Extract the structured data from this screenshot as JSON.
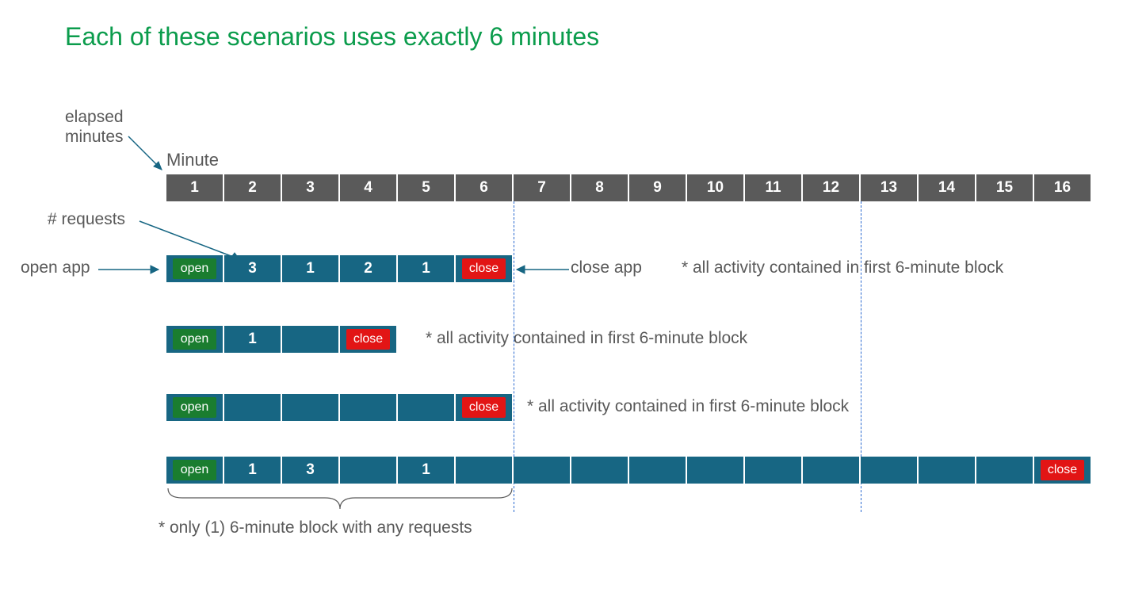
{
  "title": "Each of these scenarios uses exactly 6 minutes",
  "labels": {
    "elapsed": "elapsed\nminutes",
    "minute_header": "Minute",
    "requests": "# requests",
    "open_app": "open app",
    "close_app": "close app"
  },
  "notes": {
    "n1": "* all activity contained in first 6-minute block",
    "n2": "* all activity contained in first 6-minute block",
    "n3": "* all activity contained in first 6-minute block",
    "n4": "* only (1) 6-minute block with any requests"
  },
  "badges": {
    "open": "open",
    "close": "close"
  },
  "header_minutes": [
    "1",
    "2",
    "3",
    "4",
    "5",
    "6",
    "7",
    "8",
    "9",
    "10",
    "11",
    "12",
    "13",
    "14",
    "15",
    "16"
  ],
  "rows": [
    {
      "cells": [
        "open",
        "3",
        "1",
        "2",
        "1",
        "close"
      ]
    },
    {
      "cells": [
        "open",
        "1",
        "",
        "close"
      ]
    },
    {
      "cells": [
        "open",
        "",
        "",
        "",
        "",
        "close"
      ]
    },
    {
      "cells": [
        "open",
        "1",
        "3",
        "",
        "1",
        "",
        "",
        "",
        "",
        "",
        "",
        "",
        "",
        "",
        "",
        "close"
      ]
    }
  ],
  "chart_data": {
    "type": "table",
    "title": "Each of these scenarios uses exactly 6 minutes",
    "minutes": [
      1,
      2,
      3,
      4,
      5,
      6,
      7,
      8,
      9,
      10,
      11,
      12,
      13,
      14,
      15,
      16
    ],
    "block_boundaries_after_minute": [
      6,
      12
    ],
    "scenarios": [
      {
        "open_minute": 1,
        "close_minute": 6,
        "requests_per_minute": {
          "2": 3,
          "3": 1,
          "4": 2,
          "5": 1
        },
        "note": "all activity contained in first 6-minute block"
      },
      {
        "open_minute": 1,
        "close_minute": 4,
        "requests_per_minute": {
          "2": 1
        },
        "note": "all activity contained in first 6-minute block"
      },
      {
        "open_minute": 1,
        "close_minute": 6,
        "requests_per_minute": {},
        "note": "all activity contained in first 6-minute block"
      },
      {
        "open_minute": 1,
        "close_minute": 16,
        "requests_per_minute": {
          "2": 1,
          "3": 3,
          "5": 1
        },
        "note": "only (1) 6-minute block with any requests"
      }
    ]
  }
}
